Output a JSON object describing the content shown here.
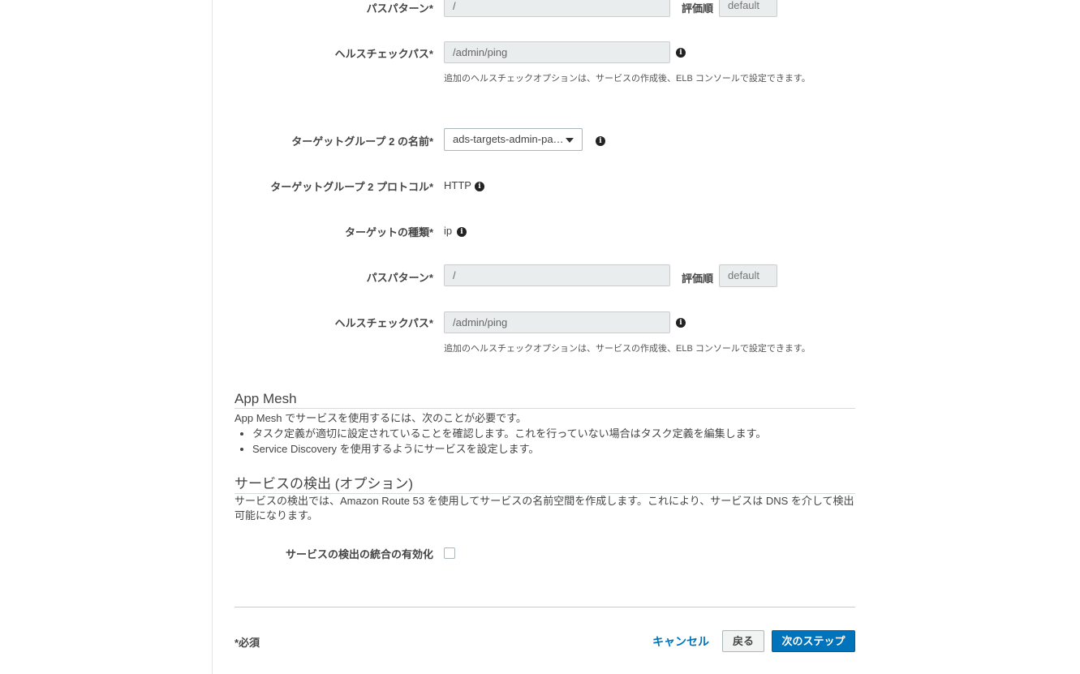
{
  "target_group_1": {
    "path_pattern_label": "パスパターン*",
    "path_pattern_value": "/",
    "eval_order_label": "評価順",
    "eval_order_value": "default",
    "health_check_label": "ヘルスチェックパス*",
    "health_check_value": "/admin/ping",
    "health_check_help": "追加のヘルスチェックオプションは、サービスの作成後、ELB コンソールで設定できます。"
  },
  "target_group_2": {
    "name_label": "ターゲットグループ 2 の名前*",
    "name_value": "ads-targets-admin-pa…",
    "protocol_label": "ターゲットグループ 2 プロトコル*",
    "protocol_value": "HTTP",
    "target_type_label": "ターゲットの種類*",
    "target_type_value": "ip",
    "path_pattern_label": "パスパターン*",
    "path_pattern_value": "/",
    "eval_order_label": "評価順",
    "eval_order_value": "default",
    "health_check_label": "ヘルスチェックパス*",
    "health_check_value": "/admin/ping",
    "health_check_help": "追加のヘルスチェックオプションは、サービスの作成後、ELB コンソールで設定できます。"
  },
  "app_mesh": {
    "title": "App Mesh",
    "intro": "App Mesh でサービスを使用するには、次のことが必要です。",
    "bullets": [
      "タスク定義が適切に設定されていることを確認します。これを行っていない場合はタスク定義を編集します。",
      "Service Discovery を使用するようにサービスを設定します。"
    ]
  },
  "service_discovery": {
    "title": "サービスの検出 (オプション)",
    "description_line1": "サービスの検出では、Amazon Route 53 を使用してサービスの名前空間を作成します。これにより、サービスは DNS を介して検出",
    "description_line2": "可能になります。",
    "enable_label": "サービスの検出の統合の有効化",
    "enabled": false
  },
  "footer": {
    "required_note": "*必須",
    "cancel_label": "キャンセル",
    "back_label": "戻る",
    "next_label": "次のステップ"
  },
  "colors": {
    "primary": "#0073bb",
    "input_bg": "#eaeded"
  },
  "icons": {
    "info": "info-icon",
    "dropdown": "caret-down-icon"
  }
}
